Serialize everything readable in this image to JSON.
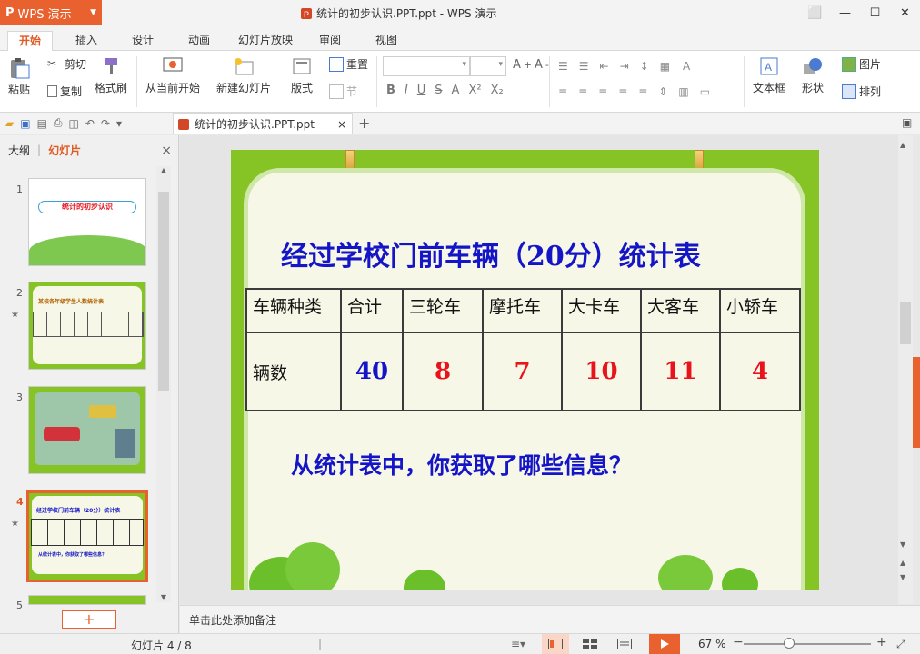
{
  "app": {
    "name": "WPS 演示",
    "logo": "P",
    "window_title": "统计的初步认识.PPT.ppt - WPS 演示"
  },
  "window_controls": {
    "restore": "⬜",
    "min": "—",
    "max": "☐",
    "close": "✕"
  },
  "ribbon_tabs": [
    "开始",
    "插入",
    "设计",
    "动画",
    "幻灯片放映",
    "审阅",
    "视图"
  ],
  "ribbon": {
    "paste": "粘贴",
    "cut": "剪切",
    "copy": "复制",
    "format_painter": "格式刷",
    "from_current": "从当前开始",
    "new_slide": "新建幻灯片",
    "layout": "版式",
    "reset": "重置",
    "section": "节",
    "textbox": "文本框",
    "shape": "形状",
    "picture": "图片",
    "arrange": "排列"
  },
  "doc_tab": {
    "label": "统计的初步认识.PPT.ppt",
    "close": "×",
    "add": "+"
  },
  "left_panel": {
    "tab_outline": "大纲",
    "tab_slides": "幻灯片",
    "close": "×",
    "add": "+"
  },
  "thumbnails": [
    {
      "num": "1",
      "star": "",
      "title": "统计的初步认识"
    },
    {
      "num": "2",
      "star": "★",
      "title": "某校各年级学生人数统计表"
    },
    {
      "num": "3",
      "star": "",
      "title": ""
    },
    {
      "num": "4",
      "star": "★",
      "title": "经过学校门前车辆（20分）统计表",
      "question": "从统计表中，你获取了哪些信息？"
    },
    {
      "num": "5",
      "star": "",
      "title": ""
    }
  ],
  "slide": {
    "title": "经过学校门前车辆（20分）统计表",
    "headers": [
      "车辆种类",
      "合计",
      "三轮车",
      "摩托车",
      "大卡车",
      "大客车",
      "小轿车"
    ],
    "row_label": "辆数",
    "values": [
      "40",
      "8",
      "7",
      "10",
      "11",
      "4"
    ],
    "question": "从统计表中，你获取了哪些信息？"
  },
  "colors": {
    "accent": "#e8612e",
    "title_blue": "#1515c8",
    "value_red": "#e8131b",
    "total_blue": "#1515c8"
  },
  "notes_placeholder": "单击此处添加备注",
  "status": {
    "slide_info": "幻灯片 4 / 8",
    "zoom": "67 %"
  }
}
